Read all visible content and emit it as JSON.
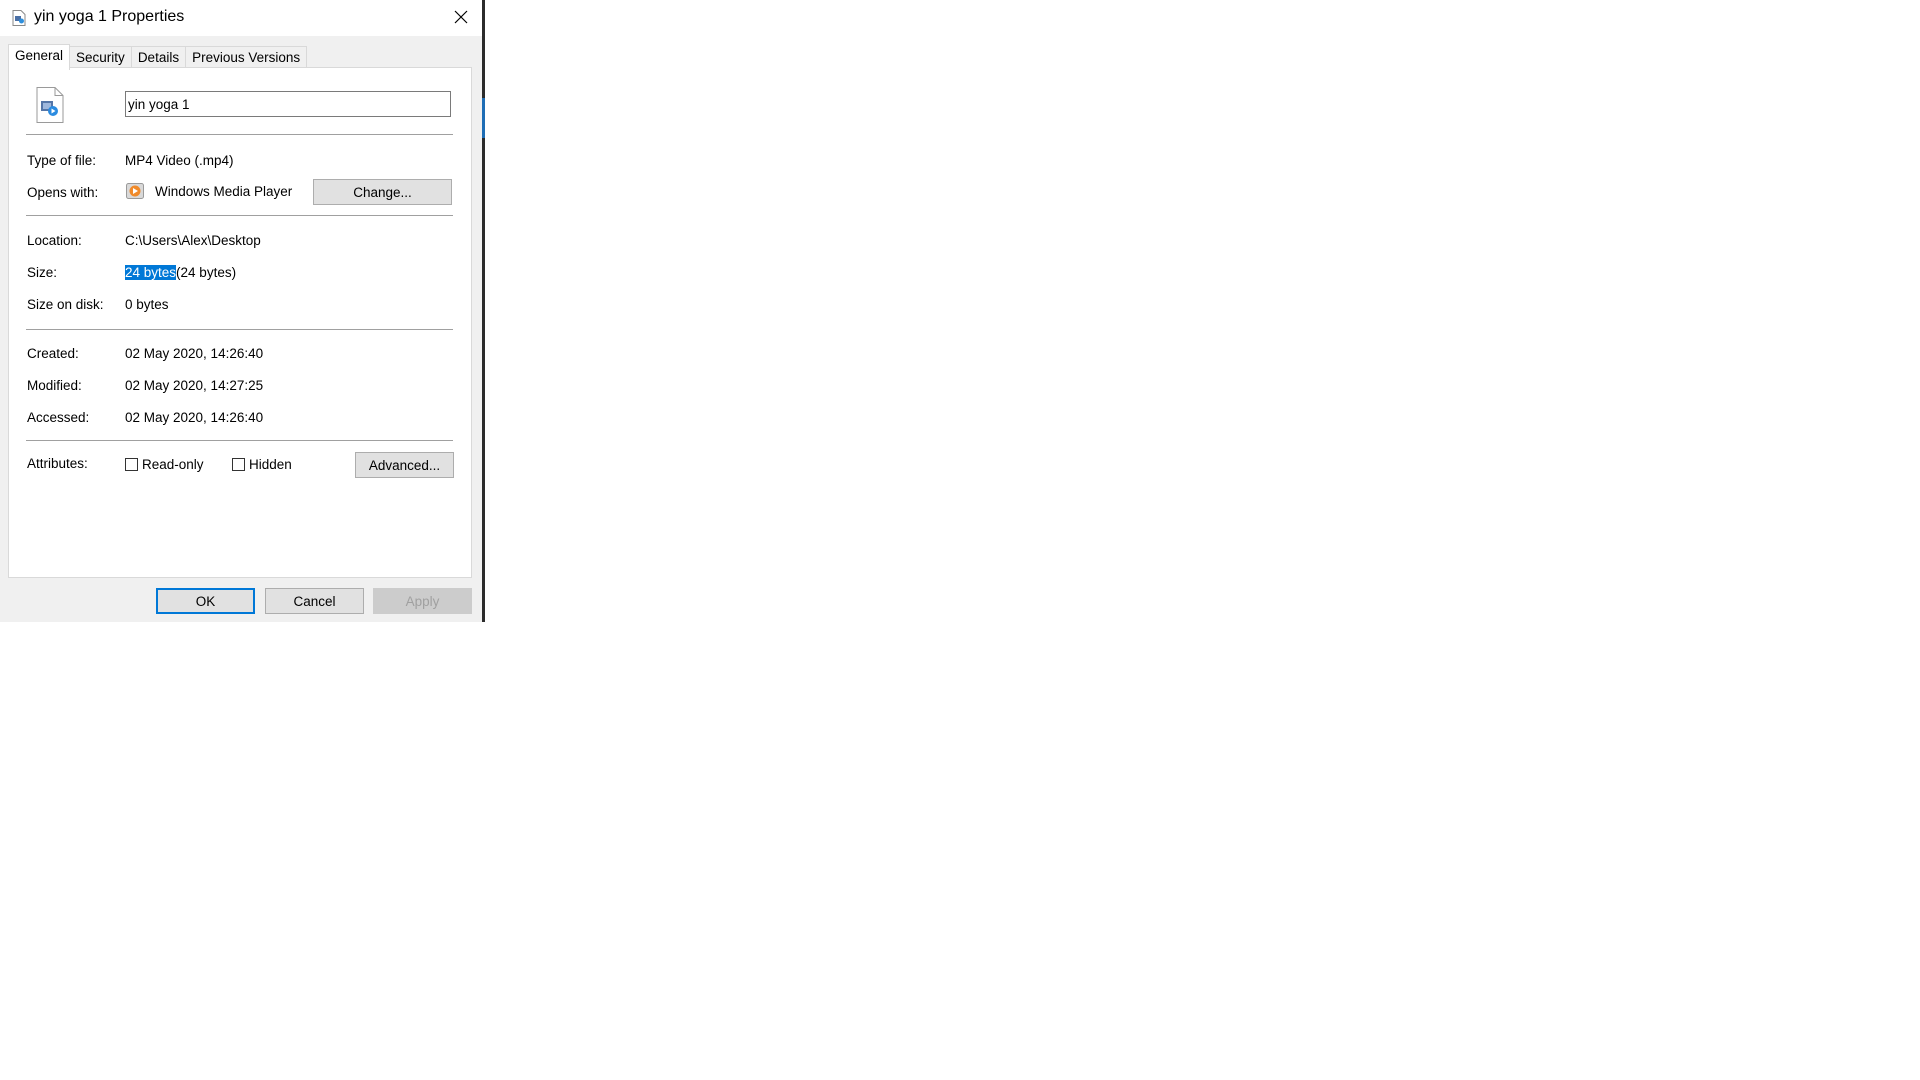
{
  "window": {
    "title": "yin yoga 1 Properties"
  },
  "tabs": [
    {
      "label": "General",
      "active": true
    },
    {
      "label": "Security",
      "active": false
    },
    {
      "label": "Details",
      "active": false
    },
    {
      "label": "Previous Versions",
      "active": false
    }
  ],
  "general": {
    "file_name": "yin yoga 1",
    "type_label": "Type of file:",
    "type_value": "MP4 Video (.mp4)",
    "opens_label": "Opens with:",
    "opens_value": "Windows Media Player",
    "change_button": "Change...",
    "location_label": "Location:",
    "location_value": "C:\\Users\\Alex\\Desktop",
    "size_label": "Size:",
    "size_selected": "24 bytes",
    "size_rest": "(24 bytes)",
    "size_disk_label": "Size on disk:",
    "size_disk_value": "0 bytes",
    "created_label": "Created:",
    "created_value": "02 May 2020, 14:26:40",
    "modified_label": "Modified:",
    "modified_value": "02 May 2020, 14:27:25",
    "accessed_label": "Accessed:",
    "accessed_value": "02 May 2020, 14:26:40",
    "attributes_label": "Attributes:",
    "readonly_label": "Read-only",
    "readonly_checked": false,
    "hidden_label": "Hidden",
    "hidden_checked": false,
    "advanced_button": "Advanced..."
  },
  "footer": {
    "ok": "OK",
    "cancel": "Cancel",
    "apply": "Apply"
  },
  "colors": {
    "selection": "#0078d7",
    "dialog_bg": "#f0f0f0",
    "accent": "#1e6db5"
  },
  "icons": {
    "title": "video-file-icon",
    "file": "video-file-icon",
    "app": "windows-media-player-icon",
    "close": "close-icon"
  }
}
